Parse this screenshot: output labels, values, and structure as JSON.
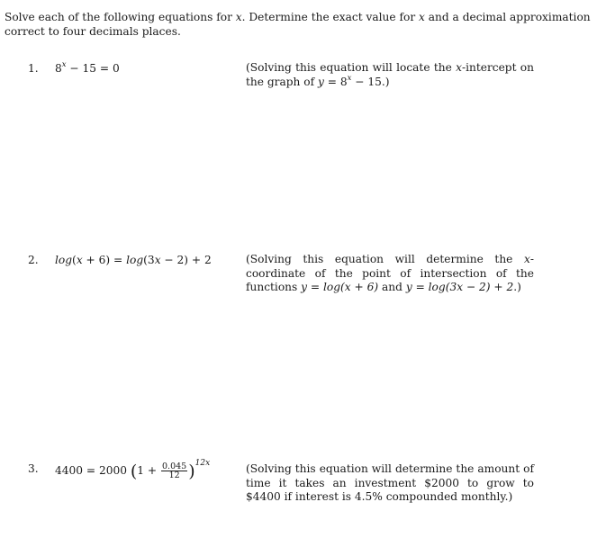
{
  "intro": {
    "part1": "Solve each of the following equations for ",
    "var": "x",
    "part2": ". Determine the exact value for ",
    "part3": " and a decimal approximation correct to four decimals places."
  },
  "problems": [
    {
      "number": "1.",
      "equation": {
        "base": "8",
        "exponent": "x",
        "rest": " − 15 = 0"
      },
      "note": {
        "text1": "(Solving this equation will locate the ",
        "var": "x",
        "text2": "-intercept on the graph of ",
        "y": "y",
        "text3": " = 8",
        "exp": "x",
        "text4": " − 15.)"
      }
    },
    {
      "number": "2.",
      "equation": {
        "lhs_fn": "log",
        "lhs_arg_open": "(",
        "lhs_var": "x",
        "lhs_arg_rest": " + 6) = ",
        "rhs_fn": "log",
        "rhs_arg_open": "(3",
        "rhs_var": "x",
        "rhs_rest": " − 2) + 2"
      },
      "note": {
        "text1": "(Solving this equation will determine the ",
        "var": "x",
        "text2": "-coordinate of the point of intersection of the functions ",
        "f1": "y = log(x + 6)",
        "text3": " and ",
        "f2": "y = log(3x − 2) + 2",
        "text4": ".)"
      }
    },
    {
      "number": "3.",
      "equation": {
        "lhs": "4400 = 2000 ",
        "open": "(",
        "one_plus": "1 + ",
        "numerator": "0.045",
        "denominator": "12",
        "close": ")",
        "exponent": "12x"
      },
      "note": {
        "text": "(Solving this equation will determine the amount of time it takes an investment $2000 to grow to $4400 if interest is 4.5% compounded monthly.)"
      }
    }
  ]
}
